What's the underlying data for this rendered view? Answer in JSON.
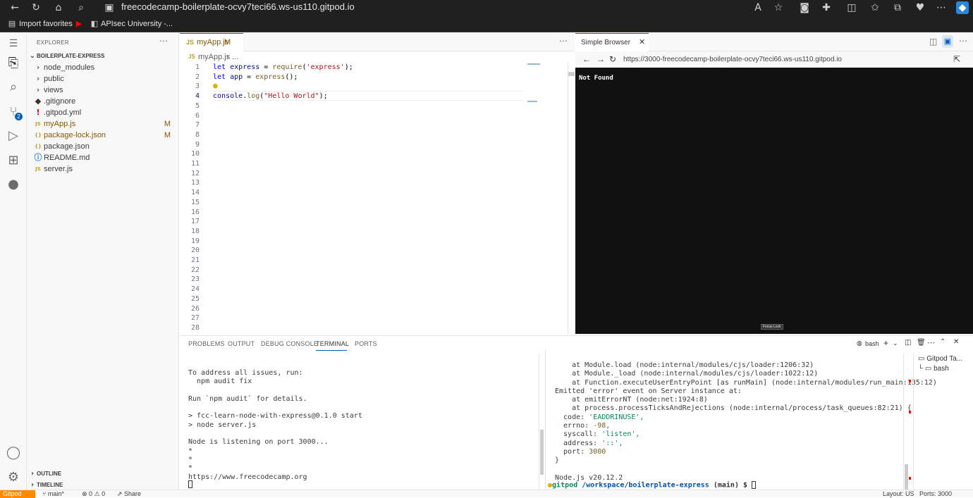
{
  "browser": {
    "url": "freecodecamp-boilerplate-ocvy7teci66.ws-us110.gitpod.io",
    "favorites": [
      "Import favorites",
      "APIsec University -..."
    ]
  },
  "sidebar": {
    "header": "EXPLORER",
    "project": "BOILERPLATE-EXPRESS",
    "items": [
      {
        "label": "node_modules",
        "icon": "chevron-right",
        "modified": false,
        "badge": ""
      },
      {
        "label": "public",
        "icon": "chevron-right",
        "modified": false,
        "badge": ""
      },
      {
        "label": "views",
        "icon": "chevron-right",
        "modified": false,
        "badge": ""
      },
      {
        "label": ".gitignore",
        "icon": "git-icon",
        "modified": false,
        "badge": ""
      },
      {
        "label": ".gitpod.yml",
        "icon": "exclaim-icon",
        "modified": false,
        "badge": ""
      },
      {
        "label": "myApp.js",
        "icon": "js-icon",
        "modified": true,
        "badge": "M"
      },
      {
        "label": "package-lock.json",
        "icon": "json-icon",
        "modified": true,
        "badge": "M"
      },
      {
        "label": "package.json",
        "icon": "json-icon",
        "modified": false,
        "badge": ""
      },
      {
        "label": "README.md",
        "icon": "info-icon",
        "modified": false,
        "badge": ""
      },
      {
        "label": "server.js",
        "icon": "js-icon",
        "modified": false,
        "badge": ""
      }
    ],
    "outline": "OUTLINE",
    "timeline": "TIMELINE"
  },
  "editor": {
    "tab_label": "myApp.js",
    "tab_badge": "M",
    "breadcrumb_file": "myApp.js",
    "breadcrumb_more": "...",
    "lines": [
      "let express = require('express');",
      "let app = express();",
      "",
      "console.log(\"Hello World\");"
    ],
    "line_count": 28,
    "active_line": 4
  },
  "simple_browser": {
    "tab_label": "Simple Browser",
    "url": "https://3000-freecodecamp-boilerplate-ocvy7teci66.ws-us110.gitpod.io",
    "content": "Not Found",
    "focus_lock": "Focus Lock"
  },
  "panel": {
    "tabs": [
      "PROBLEMS",
      "OUTPUT",
      "DEBUG CONSOLE",
      "TERMINAL",
      "PORTS"
    ],
    "active_tab": "TERMINAL",
    "shell_label": "bash",
    "terminal_left": [
      "To address all issues, run:",
      "  npm audit fix",
      "",
      "Run `npm audit` for details.",
      "",
      "> fcc-learn-node-with-express@0.1.0 start",
      "> node server.js",
      "",
      "Node is listening on port 3000...",
      "*",
      "*",
      "*",
      "https://www.freecodecamp.org"
    ],
    "terminal_right": [
      "    at Module.load (node:internal/modules/cjs/loader:1206:32)",
      "    at Module._load (node:internal/modules/cjs/loader:1022:12)",
      "    at Function.executeUserEntryPoint [as runMain] (node:internal/modules/run_main:135:12)",
      "Emitted 'error' event on Server instance at:",
      "    at emitErrorNT (node:net:1924:8)",
      "    at process.processTicksAndRejections (node:internal/process/task_queues:82:21) {",
      "  code: 'EADDRINUSE',",
      "  errno: -98,",
      "  syscall: 'listen',",
      "  address: '::',",
      "  port: 3000",
      "}",
      "",
      "Node.js v20.12.2"
    ],
    "prompt_user": "gitpod",
    "prompt_path": "/workspace/boilerplate-express",
    "prompt_branch": "(main) $",
    "terminal_list": [
      "Gitpod Ta...",
      "bash"
    ]
  },
  "status": {
    "gitpod": "Gitpod",
    "branch": "main*",
    "errors": "0",
    "warnings": "0",
    "share": "Share",
    "layout": "Layout: US",
    "ports": "Ports: 3000"
  },
  "colors": {
    "accent": "#005fb8",
    "gitpod_orange": "#ff8a00",
    "modified": "#895503",
    "browser_bg": "#111111"
  }
}
